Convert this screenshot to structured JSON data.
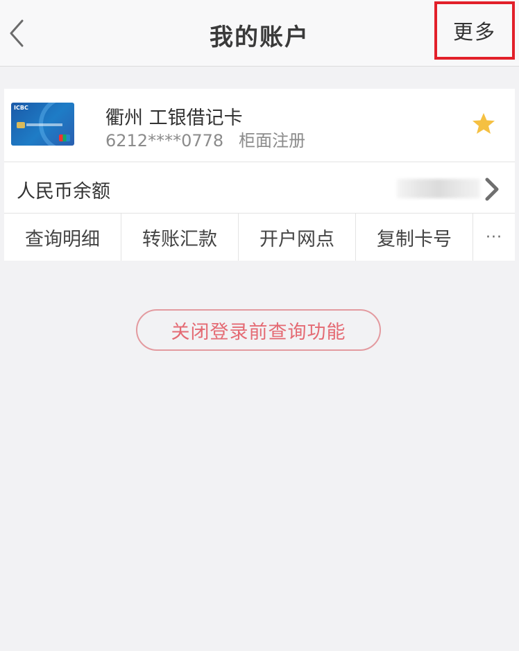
{
  "header": {
    "title": "我的账户",
    "more_label": "更多",
    "back_icon": "chevron-left-icon",
    "highlight_color": "#e2202a"
  },
  "card": {
    "name": "衢州 工银借记卡",
    "number": "6212****0778",
    "registration": "柜面注册",
    "card_art_brand": "ICBC",
    "favorite_icon": "star-icon",
    "favorite_color": "#f5c042"
  },
  "balance": {
    "label": "人民币余额",
    "value_obscured": true,
    "arrow_icon": "chevron-right-icon"
  },
  "actions": {
    "items": [
      {
        "label": "查询明细"
      },
      {
        "label": "转账汇款"
      },
      {
        "label": "开户网点"
      },
      {
        "label": "复制卡号"
      },
      {
        "label": "···"
      }
    ]
  },
  "close_query": {
    "label": "关闭登录前查询功能",
    "color": "#e46a73"
  }
}
